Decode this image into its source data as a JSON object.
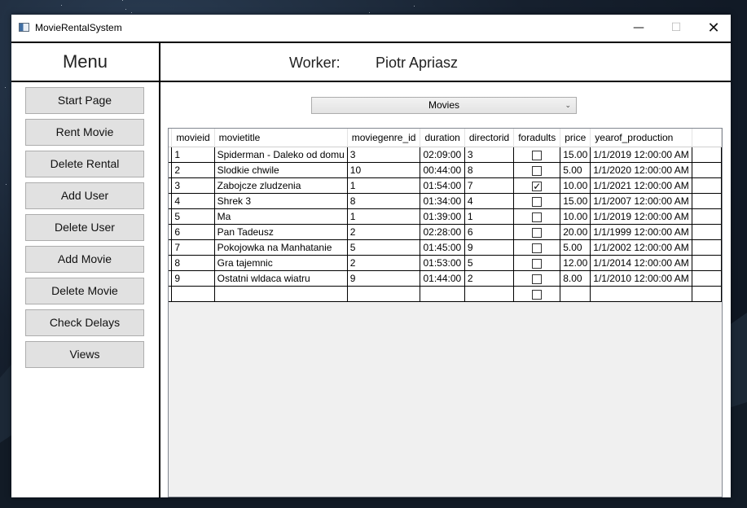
{
  "window": {
    "title": "MovieRentalSystem",
    "controls": {
      "minimize": "—",
      "maximize": "☐",
      "close": "✕"
    }
  },
  "header": {
    "menu_title": "Menu",
    "worker_label": "Worker:",
    "worker_name": "Piotr Apriasz"
  },
  "sidebar": {
    "items": [
      {
        "label": "Start Page"
      },
      {
        "label": "Rent Movie"
      },
      {
        "label": "Delete Rental"
      },
      {
        "label": "Add User"
      },
      {
        "label": "Delete User"
      },
      {
        "label": "Add Movie"
      },
      {
        "label": "Delete Movie"
      },
      {
        "label": "Check Delays"
      },
      {
        "label": "Views"
      }
    ]
  },
  "table_selector": {
    "selected": "Movies"
  },
  "grid": {
    "columns": [
      "movieid",
      "movietitle",
      "moviegenre_id",
      "duration",
      "directorid",
      "foradults",
      "price",
      "yearof_production"
    ],
    "rows": [
      {
        "movieid": "1",
        "movietitle": "Spiderman - Daleko od domu",
        "moviegenre_id": "3",
        "duration": "02:09:00",
        "directorid": "3",
        "foradults": false,
        "price": "15.00",
        "yearof_production": "1/1/2019 12:00:00 AM"
      },
      {
        "movieid": "2",
        "movietitle": "Slodkie chwile",
        "moviegenre_id": "10",
        "duration": "00:44:00",
        "directorid": "8",
        "foradults": false,
        "price": "5.00",
        "yearof_production": "1/1/2020 12:00:00 AM"
      },
      {
        "movieid": "3",
        "movietitle": "Zabojcze zludzenia",
        "moviegenre_id": "1",
        "duration": "01:54:00",
        "directorid": "7",
        "foradults": true,
        "price": "10.00",
        "yearof_production": "1/1/2021 12:00:00 AM"
      },
      {
        "movieid": "4",
        "movietitle": "Shrek 3",
        "moviegenre_id": "8",
        "duration": "01:34:00",
        "directorid": "4",
        "foradults": false,
        "price": "15.00",
        "yearof_production": "1/1/2007 12:00:00 AM"
      },
      {
        "movieid": "5",
        "movietitle": "Ma",
        "moviegenre_id": "1",
        "duration": "01:39:00",
        "directorid": "1",
        "foradults": false,
        "price": "10.00",
        "yearof_production": "1/1/2019 12:00:00 AM"
      },
      {
        "movieid": "6",
        "movietitle": "Pan Tadeusz",
        "moviegenre_id": "2",
        "duration": "02:28:00",
        "directorid": "6",
        "foradults": false,
        "price": "20.00",
        "yearof_production": "1/1/1999 12:00:00 AM"
      },
      {
        "movieid": "7",
        "movietitle": "Pokojowka na Manhatanie",
        "moviegenre_id": "5",
        "duration": "01:45:00",
        "directorid": "9",
        "foradults": false,
        "price": "5.00",
        "yearof_production": "1/1/2002 12:00:00 AM"
      },
      {
        "movieid": "8",
        "movietitle": "Gra tajemnic",
        "moviegenre_id": "2",
        "duration": "01:53:00",
        "directorid": "5",
        "foradults": false,
        "price": "12.00",
        "yearof_production": "1/1/2014 12:00:00 AM"
      },
      {
        "movieid": "9",
        "movietitle": "Ostatni wldaca wiatru",
        "moviegenre_id": "9",
        "duration": "01:44:00",
        "directorid": "2",
        "foradults": false,
        "price": "8.00",
        "yearof_production": "1/1/2010 12:00:00 AM"
      }
    ]
  }
}
